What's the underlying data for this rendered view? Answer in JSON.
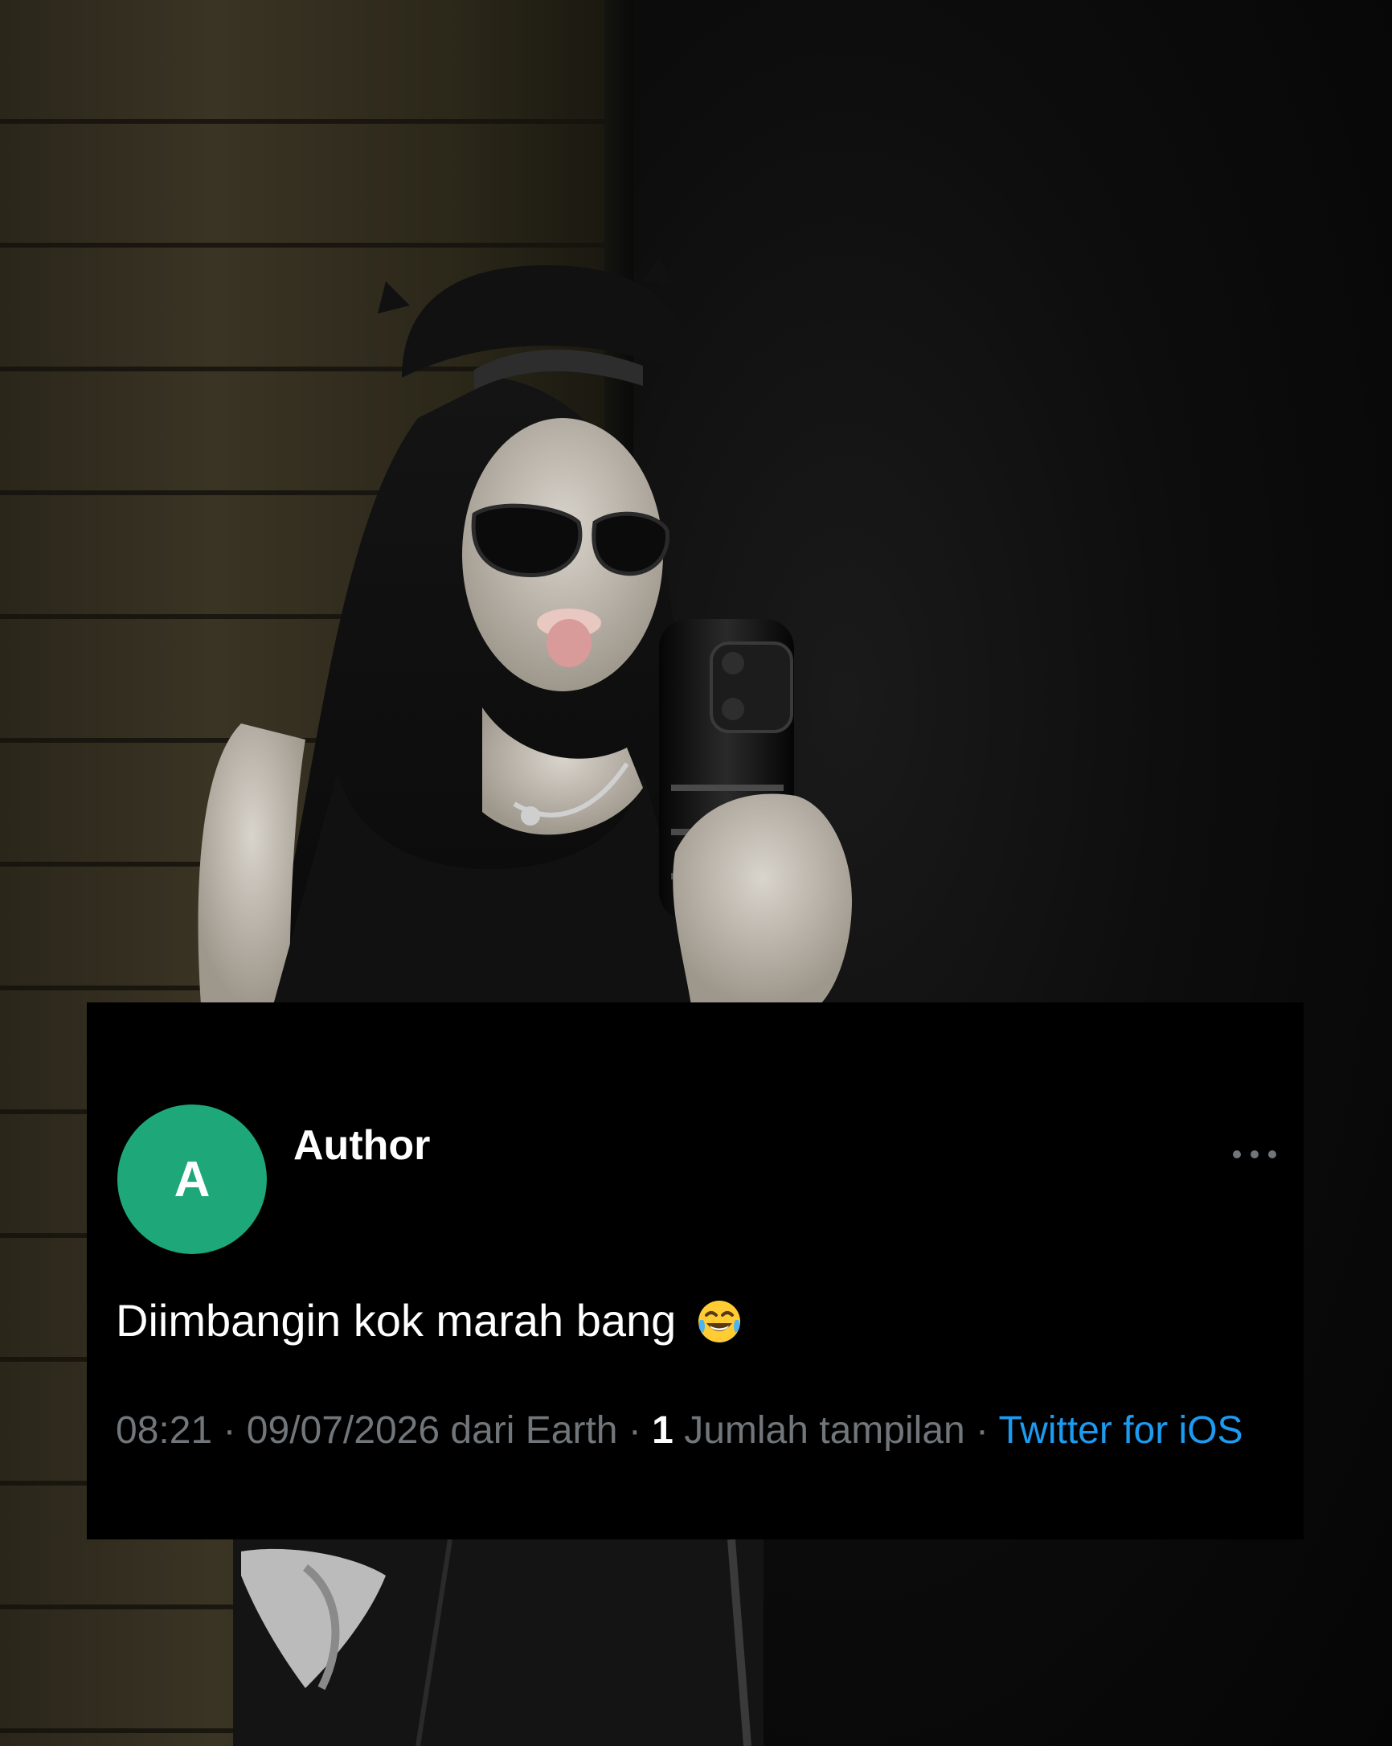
{
  "tweet": {
    "avatar_letter": "A",
    "author_name": "Author",
    "text": "Diimbangin kok marah bang",
    "emoji": "face-with-tears-of-joy",
    "time": "08:21",
    "date": "09/07/2026",
    "location": "dari Earth",
    "views_count": "1",
    "views_label": "Jumlah tampilan",
    "client": "Twitter for iOS",
    "more_icon": "more-horizontal-icon"
  },
  "colors": {
    "card_background": "#000000",
    "avatar": "#1ea879",
    "meta_text": "#71767b",
    "link": "#1d9bf0",
    "text": "#ffffff"
  }
}
